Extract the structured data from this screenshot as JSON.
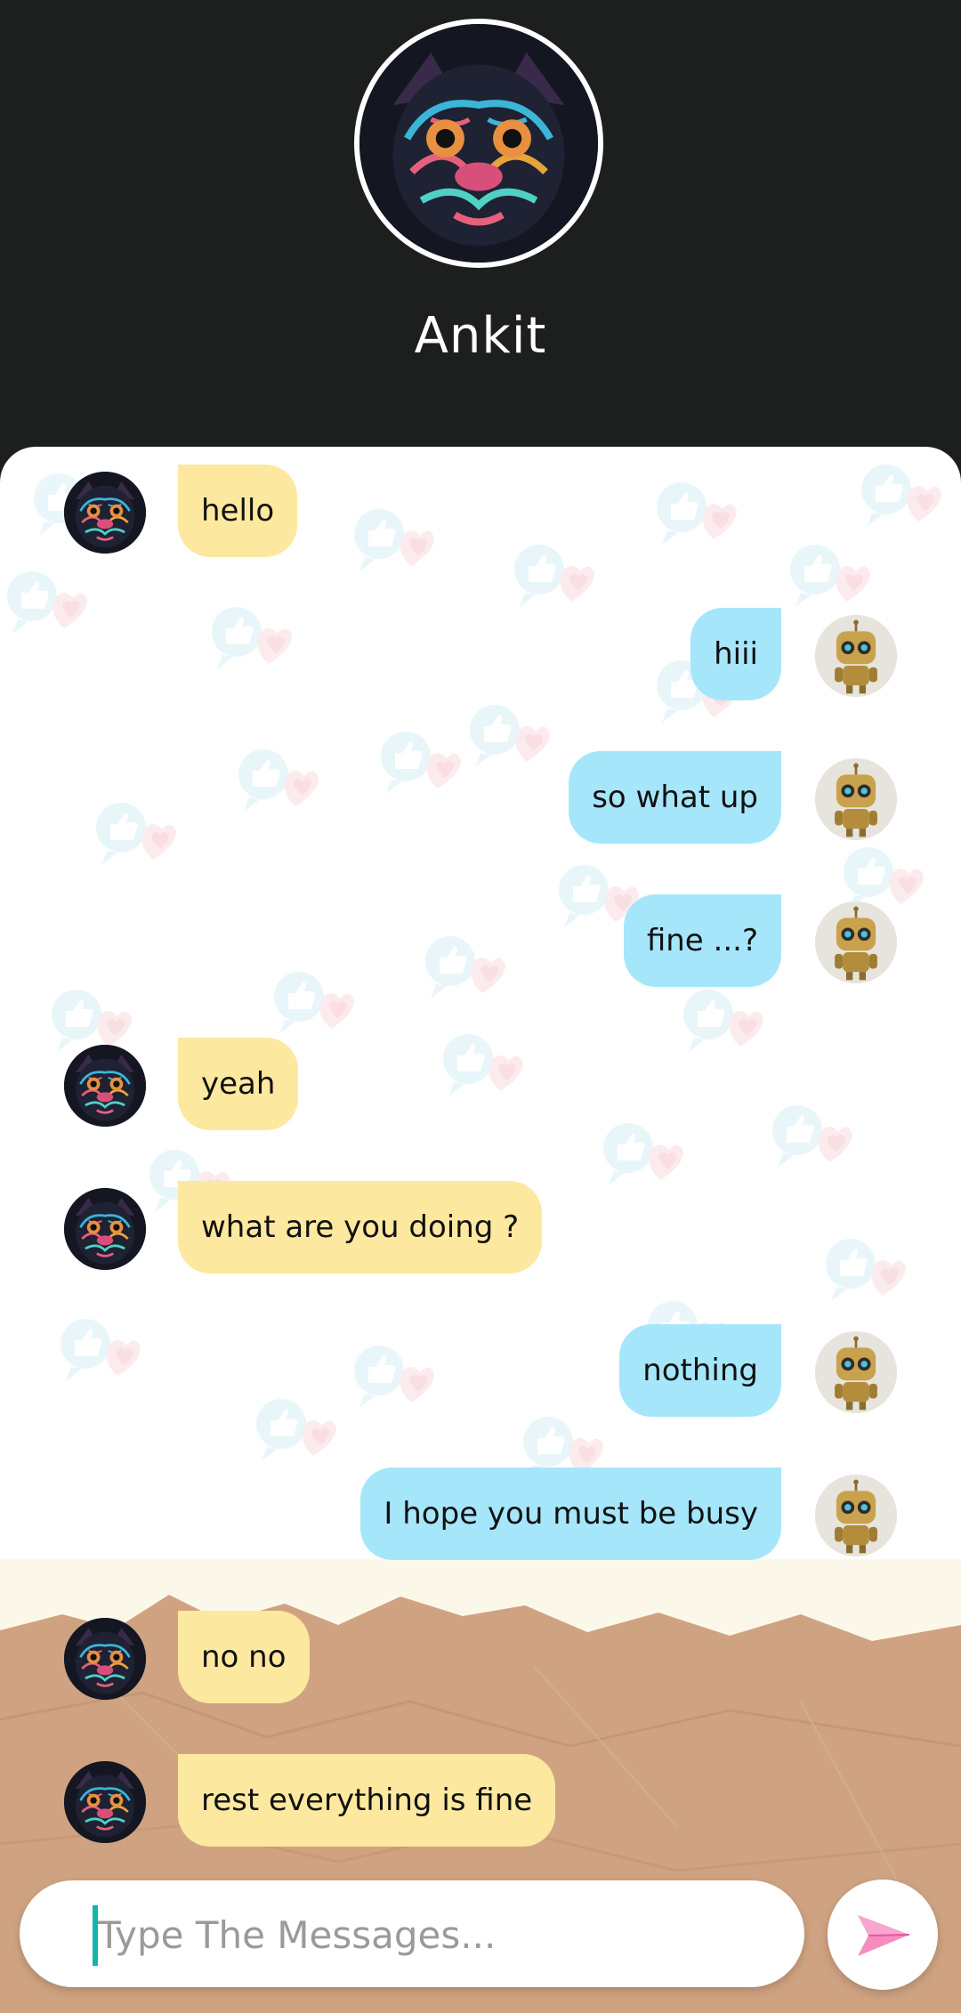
{
  "contact": {
    "name": "Ankit"
  },
  "messages": [
    {
      "side": "in",
      "text": "hello"
    },
    {
      "side": "out",
      "text": "hiii"
    },
    {
      "side": "out",
      "text": "so what up"
    },
    {
      "side": "out",
      "text": "fine ...?"
    },
    {
      "side": "in",
      "text": "yeah"
    },
    {
      "side": "in",
      "text": "what are you doing ?"
    },
    {
      "side": "out",
      "text": "nothing"
    },
    {
      "side": "out",
      "text": "I hope you must be busy"
    },
    {
      "side": "in",
      "text": "no no"
    },
    {
      "side": "in",
      "text": "rest everything is fine"
    }
  ],
  "composer": {
    "placeholder": "Type The Messages...",
    "value": ""
  },
  "icons": {
    "send": "send-paper-plane-icon",
    "contact_avatar": "pug-avatar",
    "self_avatar": "robot-avatar",
    "background_pattern": "like-heart-bubble-icon"
  },
  "colors": {
    "header_bg": "#1d1f1e",
    "incoming_bubble": "#fde89f",
    "outgoing_bubble": "#a6e6fb",
    "caret": "#12b5ac",
    "send_icon": "#f48cc0"
  }
}
